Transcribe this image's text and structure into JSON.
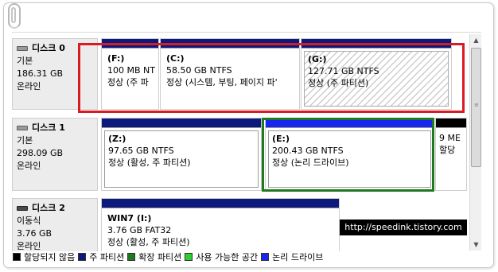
{
  "disks": [
    {
      "name": "디스크 0",
      "type": "기본",
      "size": "186.31 GB",
      "status": "온라인",
      "partitions": [
        {
          "letter": "(F:)",
          "detail": "100 MB NT",
          "status": "정상 (주 파"
        },
        {
          "letter": "(C:)",
          "detail": "58.50 GB NTFS",
          "status": "정상 (시스템, 부팅, 페이지 파'"
        },
        {
          "letter": "(G:)",
          "detail": "127.71 GB NTFS",
          "status": "정상 (주 파티션)"
        }
      ]
    },
    {
      "name": "디스크 1",
      "type": "기본",
      "size": "298.09 GB",
      "status": "온라인",
      "partitions": [
        {
          "letter": "(Z:)",
          "detail": "97.65 GB NTFS",
          "status": "정상 (활성, 주 파티션)"
        },
        {
          "letter": "(E:)",
          "detail": "200.43 GB NTFS",
          "status": "정상 (논리 드라이브)"
        },
        {
          "letter": "",
          "detail": "9 ME",
          "status": "할당"
        }
      ]
    },
    {
      "name": "디스크 2",
      "type": "이동식",
      "size": "3.76 GB",
      "status": "온라인",
      "partitions": [
        {
          "letter": "WIN7  (I:)",
          "detail": "3.76 GB FAT32",
          "status": "정상 (활성, 주 파티션)"
        }
      ]
    }
  ],
  "watermark": "http://speedink.tistory.com",
  "legend": [
    "할당되지 않음",
    "주 파티션",
    "확장 파티션",
    "사용 가능한 공간",
    "논리 드라이브"
  ],
  "colors": {
    "primary": "#0b1a7c",
    "logical": "#1a25ef",
    "unallocated": "#000000",
    "extended": "#1e7a1e",
    "free": "#2ad12a",
    "highlight_red": "#d91b24",
    "highlight_green": "#1e7a1e"
  }
}
